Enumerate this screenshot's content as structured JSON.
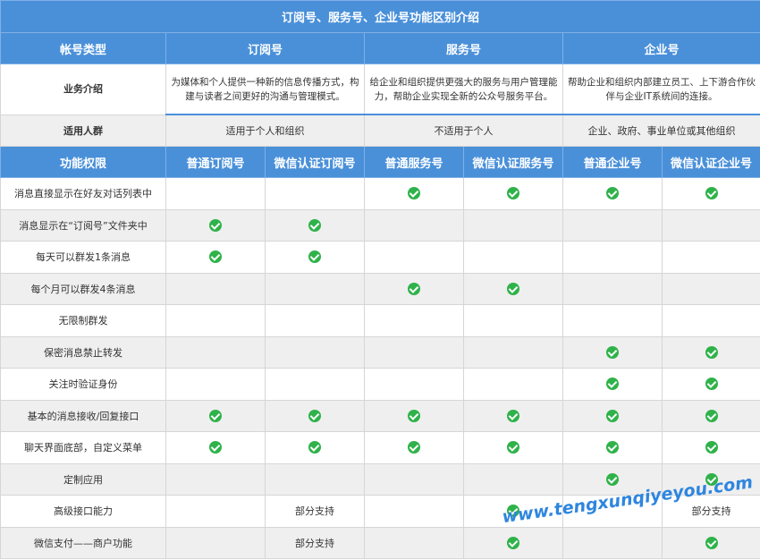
{
  "title": "订阅号、服务号、企业号功能区别介绍",
  "header": {
    "col_label": "帐号类型",
    "types": [
      "订阅号",
      "服务号",
      "企业号"
    ]
  },
  "intro": {
    "label": "业务介绍",
    "values": [
      "为媒体和个人提供一种新的信息传播方式，构建与读者之间更好的沟通与管理模式。",
      "给企业和组织提供更强大的服务与用户管理能力，帮助企业实现全新的公众号服务平台。",
      "帮助企业和组织内部建立员工、上下游合作伙伴与企业IT系统间的连接。"
    ]
  },
  "audience": {
    "label": "适用人群",
    "values": [
      "适用于个人和组织",
      "不适用于个人",
      "企业、政府、事业单位或其他组织"
    ]
  },
  "features_header": {
    "label": "功能权限",
    "subtypes": [
      "普通订阅号",
      "微信认证订阅号",
      "普通服务号",
      "微信认证服务号",
      "普通企业号",
      "微信认证企业号"
    ]
  },
  "check_icon": "check-circle-icon",
  "check_color": "#2fb24a",
  "header_color": "#4a90d9",
  "features": [
    {
      "name": "消息直接显示在好友对话列表中",
      "cells": [
        "",
        "",
        "check",
        "check",
        "check",
        "check"
      ]
    },
    {
      "name": "消息显示在“订阅号”文件夹中",
      "cells": [
        "check",
        "check",
        "",
        "",
        "",
        ""
      ]
    },
    {
      "name": "每天可以群发1条消息",
      "cells": [
        "check",
        "check",
        "",
        "",
        "",
        ""
      ]
    },
    {
      "name": "每个月可以群发4条消息",
      "cells": [
        "",
        "",
        "check",
        "check",
        "",
        ""
      ]
    },
    {
      "name": "无限制群发",
      "cells": [
        "",
        "",
        "",
        "",
        "",
        ""
      ]
    },
    {
      "name": "保密消息禁止转发",
      "cells": [
        "",
        "",
        "",
        "",
        "check",
        "check"
      ]
    },
    {
      "name": "关注时验证身份",
      "cells": [
        "",
        "",
        "",
        "",
        "check",
        "check"
      ]
    },
    {
      "name": "基本的消息接收/回复接口",
      "cells": [
        "check",
        "check",
        "check",
        "check",
        "check",
        "check"
      ]
    },
    {
      "name": "聊天界面底部，自定义菜单",
      "cells": [
        "check",
        "check",
        "check",
        "check",
        "check",
        "check"
      ]
    },
    {
      "name": "定制应用",
      "cells": [
        "",
        "",
        "",
        "",
        "check",
        "check"
      ]
    },
    {
      "name": "高级接口能力",
      "cells": [
        "",
        "部分支持",
        "",
        "check",
        "",
        "部分支持"
      ]
    },
    {
      "name": "微信支付——商户功能",
      "cells": [
        "",
        "部分支持",
        "",
        "check",
        "",
        "check"
      ]
    }
  ],
  "watermark": "www.tengxunqiyeyou.com"
}
